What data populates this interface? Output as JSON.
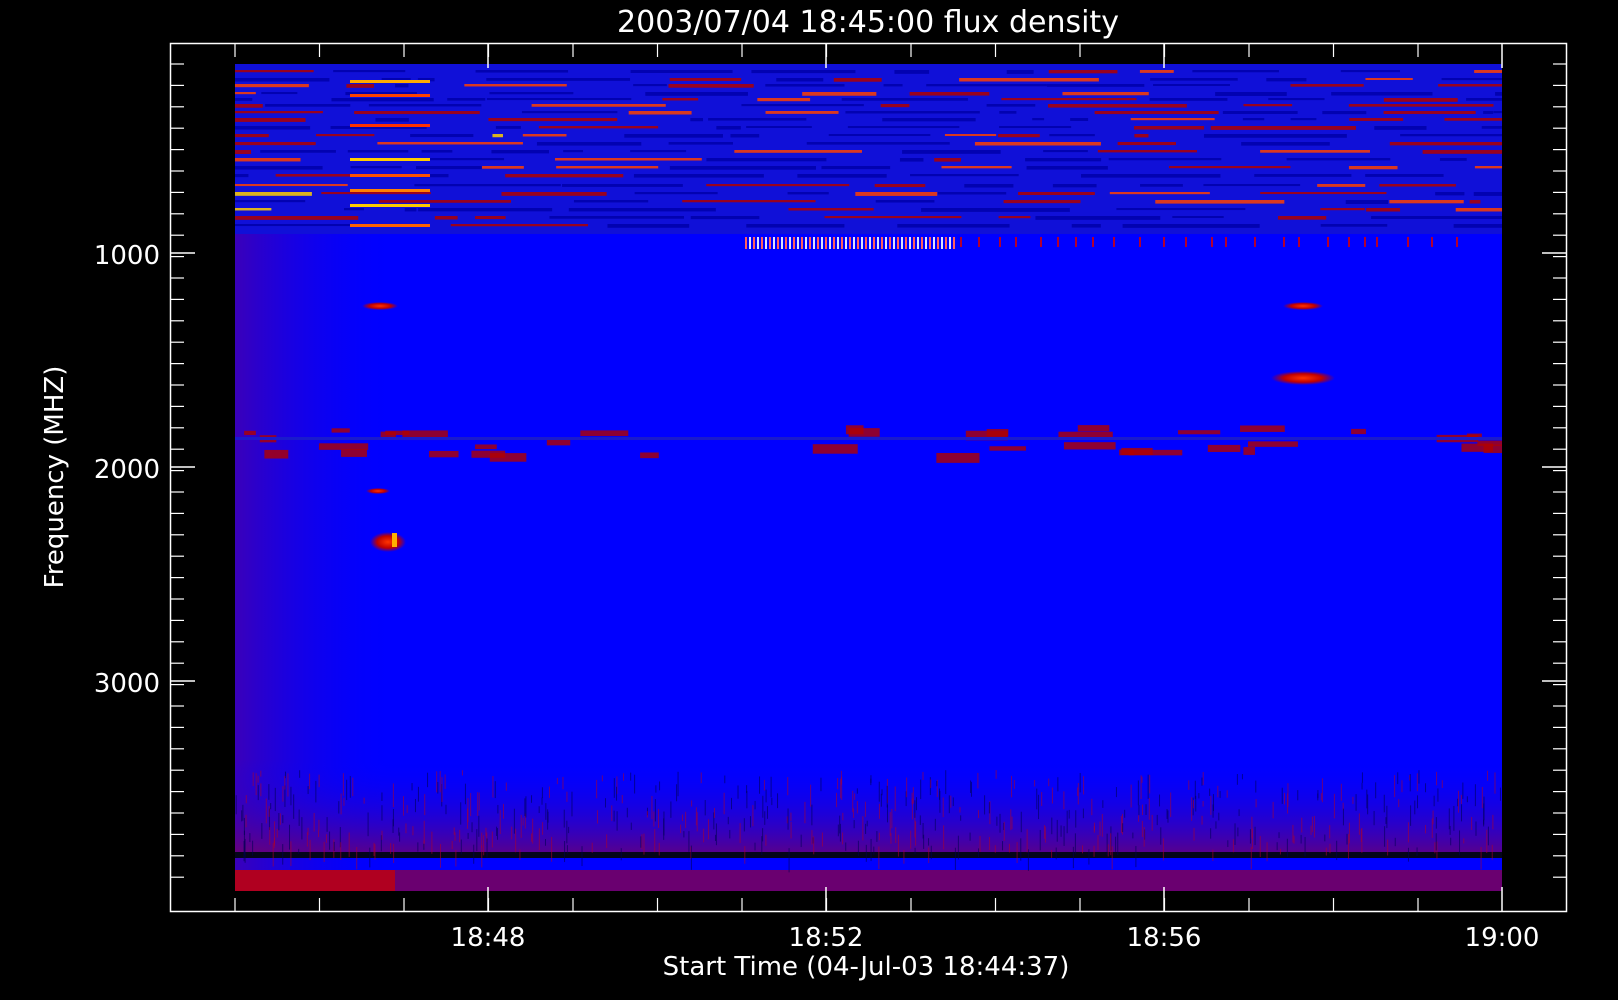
{
  "chart_data": {
    "type": "heatmap",
    "title": "2003/07/04 18:45:00 flux density",
    "xlabel": "Start Time (04-Jul-03 18:44:37)",
    "ylabel": "Frequency (MHZ)",
    "x_tick_labels": [
      "18:48",
      "18:52",
      "18:56",
      "19:00"
    ],
    "x_tick_minutes": [
      3.38,
      7.38,
      11.38,
      15.38
    ],
    "y_tick_labels": [
      "1000",
      "2000",
      "3000"
    ],
    "y_tick_values": [
      1000,
      2000,
      3000
    ],
    "x_range_minutes": [
      0,
      15.38
    ],
    "y_range_mhz": [
      100,
      4000
    ],
    "y_reversed": true,
    "colors": {
      "background": "#000000",
      "low": "#0000ff",
      "medium": "#cc0000",
      "high": "#ffd000",
      "axes": "#ffffff"
    },
    "features": [
      {
        "minute": 1.7,
        "freq_mhz": 250,
        "intensity": "high"
      },
      {
        "minute": 1.7,
        "freq_mhz": 550,
        "intensity": "high"
      },
      {
        "minute": 1.7,
        "freq_mhz": 720,
        "intensity": "high"
      },
      {
        "minute": 1.7,
        "freq_mhz": 1250,
        "intensity": "medium"
      },
      {
        "minute": 1.9,
        "freq_mhz": 2350,
        "intensity": "high"
      },
      {
        "minute": 12.6,
        "freq_mhz": 1580,
        "intensity": "medium"
      },
      {
        "minute": 12.6,
        "freq_mhz": 1250,
        "intensity": "medium"
      }
    ]
  }
}
